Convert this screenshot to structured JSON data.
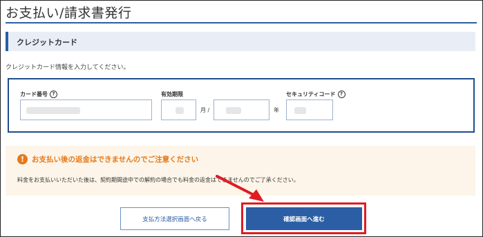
{
  "page": {
    "title": "お支払い/請求書発行"
  },
  "credit_card": {
    "section_title": "クレジットカード",
    "instruction": "クレジットカード情報を入力してください。",
    "card_number_label": "カード番号",
    "expiry_label": "有効期限",
    "month_unit": "月 /",
    "year_unit": "年",
    "security_code_label": "セキュリティコード",
    "help_glyph": "?"
  },
  "notice": {
    "icon_glyph": "!",
    "title": "お支払い後の返金はできませんのでご注意ください",
    "body": "料金をお支払いいただいた後は、契約期間途中での解約の場合でも料金の返金はできませんのでご了承ください。"
  },
  "actions": {
    "back_label": "支払方法選択画面へ戻る",
    "confirm_label": "確認画面へ進む"
  },
  "colors": {
    "accent": "#2b5ea4",
    "warning": "#e5791a",
    "annotation": "#e01b22"
  }
}
